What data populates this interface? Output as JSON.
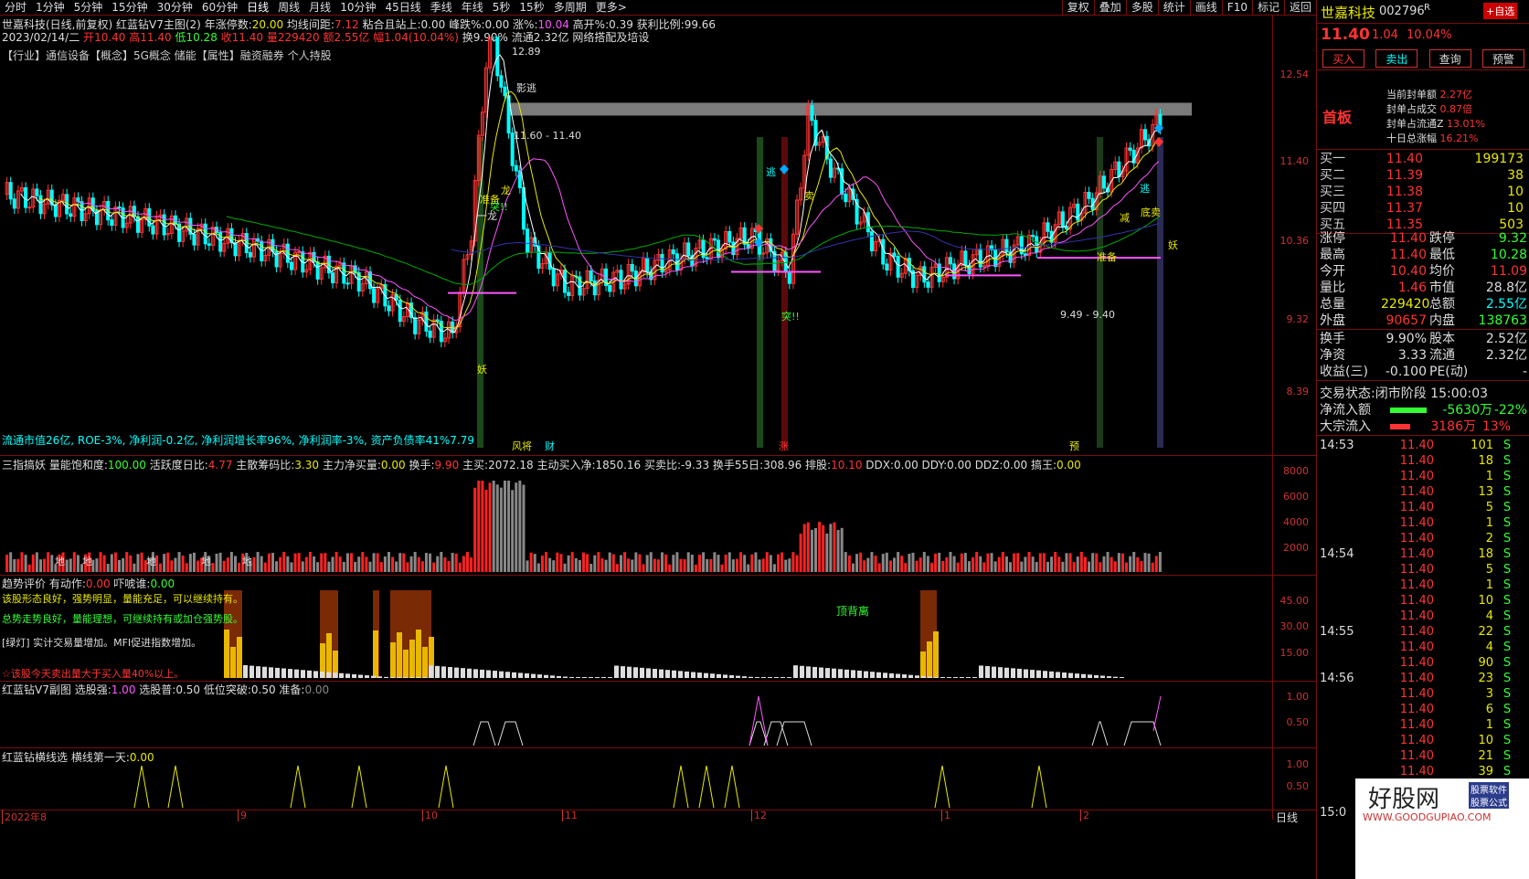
{
  "toolbar": {
    "periods": [
      "分时",
      "1分钟",
      "5分钟",
      "15分钟",
      "30分钟",
      "60分钟",
      "日线",
      "周线",
      "月线",
      "10分钟",
      "45日线",
      "季线",
      "年线",
      "5秒",
      "15秒",
      "多周期",
      "更多>"
    ],
    "right_buttons": [
      "复权",
      "叠加",
      "多股",
      "统计",
      "画线",
      "F10",
      "标记",
      "返回"
    ]
  },
  "main_chart": {
    "title_line": "世嘉科技(日线,前复权)",
    "indicator_name": "红蓝钻V7主图(2)",
    "params": [
      {
        "label": "年涨停数:",
        "value": "20.00",
        "color": "#e8e800"
      },
      {
        "label": "均线间距:",
        "value": "7.12",
        "color": "#ff3333"
      },
      {
        "label": "粘合且站上:",
        "value": "0.00",
        "color": "#ddd"
      },
      {
        "label": "峰跌%:",
        "value": "0.00",
        "color": "#ddd"
      },
      {
        "label": "涨%:",
        "value": "10.04",
        "color": "#ff55ff"
      },
      {
        "label": "高开%:",
        "value": "0.39",
        "color": "#ddd"
      },
      {
        "label": "获利比例:",
        "value": "99.66",
        "color": "#ddd"
      }
    ],
    "date_line": "2023/02/14/二",
    "ohlc": [
      {
        "label": "开",
        "value": "10.40",
        "color": "#ff3333"
      },
      {
        "label": "高",
        "value": "11.40",
        "color": "#ff3333"
      },
      {
        "label": "低",
        "value": "10.28",
        "color": "#33ff33"
      },
      {
        "label": "收",
        "value": "11.40",
        "color": "#ff3333"
      },
      {
        "label": "量",
        "value": "229420",
        "color": "#ff3333"
      },
      {
        "label": "额",
        "value": "2.55亿",
        "color": "#ff3333"
      },
      {
        "label": "幅",
        "value": "1.04(10.04%)",
        "color": "#ff3333"
      },
      {
        "label": "换",
        "value": "9.90%",
        "color": "#ddd"
      },
      {
        "label": "流通",
        "value": "2.32亿",
        "color": "#ddd"
      }
    ],
    "ohlc_tail": "网络搭配及培设",
    "industry_line": "【行业】通信设备【概念】5G概念 储能【属性】融资融券 个人持股",
    "fundamentals": "流通市值26亿, ROE-3%, 净利润-0.2亿, 净利润增长率96%, 净利润率-3%, 资产负债率41%7.79",
    "y_axis": [
      "12.54",
      "11.40",
      "10.36",
      "9.32",
      "8.39"
    ],
    "annotations": {
      "high": "12.89",
      "range": "11.60 - 11.40",
      "escape1": "影逃",
      "dragon": "龙",
      "zhunbei": "准备",
      "tu": "突!!",
      "yao": "妖",
      "yi_long": "一龙",
      "escape": "逃",
      "sell": "卖",
      "zhun": "准备",
      "tu2": "突!!",
      "dijian": "减",
      "range2": "9.49 - 9.40",
      "yao2": "妖",
      "ditan": "底卖",
      "fenjiang": "风将",
      "cai": "财",
      "zhang": "涨",
      "yu": "预"
    }
  },
  "vol_panel": {
    "name": "三指搞妖",
    "params": [
      {
        "label": "量能饱和度:",
        "value": "100.00",
        "color": "#33ff33"
      },
      {
        "label": "活跃度日比:",
        "value": "4.77",
        "color": "#ff3333"
      },
      {
        "label": "主散筹码比:",
        "value": "3.30",
        "color": "#e8e800"
      },
      {
        "label": "主力净买量:",
        "value": "0.00",
        "color": "#e8e800"
      },
      {
        "label": "换手:",
        "value": "9.90",
        "color": "#ff3333"
      },
      {
        "label": "主买:",
        "value": "2072.18",
        "color": "#ddd"
      },
      {
        "label": "主动买入净:",
        "value": "1850.16",
        "color": "#ddd"
      },
      {
        "label": "买卖比:",
        "value": "-9.33",
        "color": "#ddd"
      },
      {
        "label": "换手55日:",
        "value": "308.96",
        "color": "#ddd"
      },
      {
        "label": "排股:",
        "value": "10.10",
        "color": "#ff3333"
      },
      {
        "label": "DDX:",
        "value": "0.00",
        "color": "#ddd"
      },
      {
        "label": "DDY:",
        "value": "0.00",
        "color": "#ddd"
      },
      {
        "label": "DDZ:",
        "value": "0.00",
        "color": "#ddd"
      },
      {
        "label": "搞王:",
        "value": "0.00",
        "color": "#e8e800"
      }
    ],
    "y_axis": [
      "8000",
      "6000",
      "4000",
      "2000"
    ],
    "marker": "地"
  },
  "trend_panel": {
    "name": "趋势评价",
    "params": [
      {
        "label": "有动作:",
        "value": "0.00",
        "color": "#ff3333"
      },
      {
        "label": "吓唬谁:",
        "value": "0.00",
        "color": "#33ff33"
      }
    ],
    "msgs": [
      {
        "text": "该股形态良好，强势明显，量能充足，可以继续持有。",
        "color": "#e8e800"
      },
      {
        "text": "总势走势良好，量能理想，可继续持有或加仓强势股。",
        "color": "#33ff33"
      },
      {
        "text": "[绿灯] 实计交易量增加。MFI促进指数增加。",
        "color": "#ddd"
      },
      {
        "text": "☆该股今天卖出量大于买入量40%以上。",
        "color": "#ff3333"
      }
    ],
    "label_top": "顶背离",
    "y_axis": [
      "45.00",
      "30.00",
      "15.00"
    ]
  },
  "sub_panel": {
    "name": "红蓝钻V7副图",
    "params": [
      {
        "label": "选股强:",
        "value": "1.00",
        "color": "#ff55ff"
      },
      {
        "label": "选股普:",
        "value": "0.50",
        "color": "#ddd"
      },
      {
        "label": "低位突破:",
        "value": "0.50",
        "color": "#ddd"
      },
      {
        "label": "准备:",
        "value": "0.00",
        "color": "#888"
      }
    ],
    "y_axis": [
      "1.00",
      "0.50"
    ]
  },
  "line_panel": {
    "name": "红蓝钻横线选",
    "params": [
      {
        "label": "横线第一天:",
        "value": "0.00",
        "color": "#e8e800"
      }
    ],
    "y_axis": [
      "1.00",
      "0.50"
    ]
  },
  "x_axis": {
    "labels": [
      "2022年8",
      "9",
      "10",
      "11",
      "12",
      "1",
      "2"
    ],
    "period": "日线"
  },
  "quote": {
    "name": "世嘉科技",
    "code": "002796",
    "suffix": "R",
    "add_label": "+自选",
    "price": "11.40",
    "change": "1.04",
    "pct": "10.04%",
    "buttons": [
      "买入",
      "卖出",
      "查询",
      "预警"
    ],
    "tag": "首板",
    "seal": [
      {
        "label": "当前封单额",
        "value": "2.27亿"
      },
      {
        "label": "封单占成交",
        "value": "0.87倍"
      },
      {
        "label": "封单占流通Z",
        "value": "13.01%"
      },
      {
        "label": "十日总涨幅",
        "value": "16.21%"
      }
    ],
    "bids": [
      {
        "label": "买一",
        "price": "11.40",
        "vol": "199173"
      },
      {
        "label": "买二",
        "price": "11.39",
        "vol": "38"
      },
      {
        "label": "买三",
        "price": "11.38",
        "vol": "10"
      },
      {
        "label": "买四",
        "price": "11.37",
        "vol": "10"
      },
      {
        "label": "买五",
        "price": "11.35",
        "vol": "503"
      }
    ],
    "stats": [
      {
        "l1": "涨停",
        "v1": "11.40",
        "c1": "#ff3333",
        "l2": "跌停",
        "v2": "9.32",
        "c2": "#33ff33"
      },
      {
        "l1": "最高",
        "v1": "11.40",
        "c1": "#ff3333",
        "l2": "最低",
        "v2": "10.28",
        "c2": "#33ff33"
      },
      {
        "l1": "今开",
        "v1": "10.40",
        "c1": "#ff3333",
        "l2": "均价",
        "v2": "11.09",
        "c2": "#ff3333"
      },
      {
        "l1": "量比",
        "v1": "1.46",
        "c1": "#ff3333",
        "l2": "市值",
        "v2": "28.8亿",
        "c2": "#ddd"
      },
      {
        "l1": "总量",
        "v1": "229420",
        "c1": "#e8e800",
        "l2": "总额",
        "v2": "2.55亿",
        "c2": "#00ffff"
      },
      {
        "l1": "外盘",
        "v1": "90657",
        "c1": "#ff3333",
        "l2": "内盘",
        "v2": "138763",
        "c2": "#33ff33"
      }
    ],
    "stats2": [
      {
        "l1": "换手",
        "v1": "9.90%",
        "l2": "股本",
        "v2": "2.52亿"
      },
      {
        "l1": "净资",
        "v1": "3.33",
        "l2": "流通",
        "v2": "2.32亿"
      },
      {
        "l1": "收益(三)",
        "v1": "-0.100",
        "l2": "PE(动)",
        "v2": "-"
      }
    ],
    "status_label": "交易状态:",
    "status": "闭市阶段 15:00:03",
    "flows": [
      {
        "label": "净流入额",
        "value": "-5630万",
        "pct": "-22%",
        "color": "#33ff33"
      },
      {
        "label": "大宗流入",
        "value": "3186万",
        "pct": "13%",
        "color": "#ff3333"
      }
    ],
    "ticks": [
      {
        "t": "14:53",
        "p": "11.40",
        "n": "101",
        "s": "S"
      },
      {
        "t": "",
        "p": "11.40",
        "n": "18",
        "s": "S"
      },
      {
        "t": "",
        "p": "11.40",
        "n": "1",
        "s": "S"
      },
      {
        "t": "",
        "p": "11.40",
        "n": "13",
        "s": "S"
      },
      {
        "t": "",
        "p": "11.40",
        "n": "5",
        "s": "S"
      },
      {
        "t": "",
        "p": "11.40",
        "n": "1",
        "s": "S"
      },
      {
        "t": "",
        "p": "11.40",
        "n": "2",
        "s": "S"
      },
      {
        "t": "14:54",
        "p": "11.40",
        "n": "18",
        "s": "S"
      },
      {
        "t": "",
        "p": "11.40",
        "n": "5",
        "s": "S"
      },
      {
        "t": "",
        "p": "11.40",
        "n": "1",
        "s": "S"
      },
      {
        "t": "",
        "p": "11.40",
        "n": "10",
        "s": "S"
      },
      {
        "t": "",
        "p": "11.40",
        "n": "4",
        "s": "S"
      },
      {
        "t": "14:55",
        "p": "11.40",
        "n": "22",
        "s": "S"
      },
      {
        "t": "",
        "p": "11.40",
        "n": "4",
        "s": "S"
      },
      {
        "t": "",
        "p": "11.40",
        "n": "90",
        "s": "S"
      },
      {
        "t": "14:56",
        "p": "11.40",
        "n": "23",
        "s": "S"
      },
      {
        "t": "",
        "p": "11.40",
        "n": "3",
        "s": "S"
      },
      {
        "t": "",
        "p": "11.40",
        "n": "6",
        "s": "S"
      },
      {
        "t": "",
        "p": "11.40",
        "n": "1",
        "s": "S"
      },
      {
        "t": "",
        "p": "11.40",
        "n": "10",
        "s": "S"
      },
      {
        "t": "",
        "p": "11.40",
        "n": "21",
        "s": "S"
      },
      {
        "t": "",
        "p": "11.40",
        "n": "39",
        "s": "S"
      }
    ],
    "last_time": "15:0"
  },
  "watermark": {
    "brand": "好股网",
    "badge1": "股票软件",
    "badge2": "股票公式",
    "url": "WWW.GOODGUPIAO.COM"
  }
}
